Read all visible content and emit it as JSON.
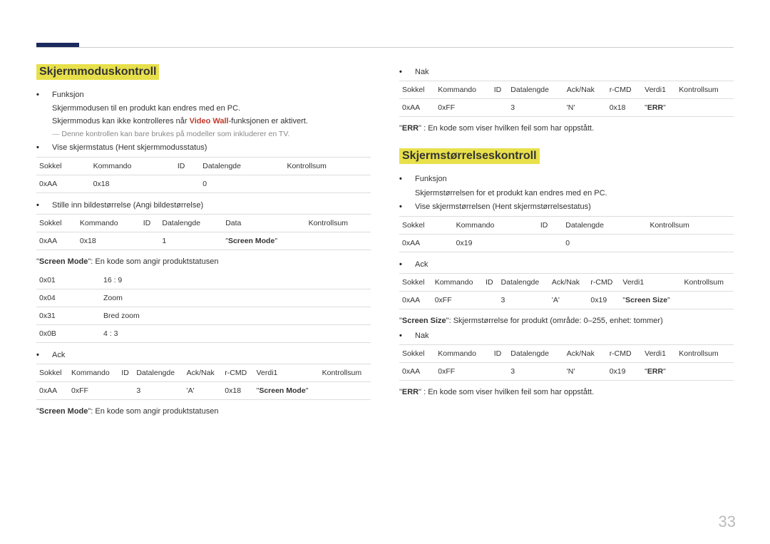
{
  "pageNumber": "33",
  "left": {
    "title": "Skjermmoduskontroll",
    "funksjonLabel": "Funksjon",
    "funksjonText1": "Skjermmodusen til en produkt kan endres med en PC.",
    "funksjonText2a": "Skjermmodus kan ikke kontrolleres når ",
    "funksjonText2Red": "Video Wall",
    "funksjonText2b": "-funksjonen er aktivert.",
    "note": "Denne kontrollen kan bare brukes på modeller som inkluderer en TV.",
    "vise": "Vise skjermstatus (Hent skjermmodusstatus)",
    "t1": {
      "h": [
        "Sokkel",
        "Kommando",
        "ID",
        "Datalengde",
        "Kontrollsum"
      ],
      "r": [
        "0xAA",
        "0x18",
        "",
        "0",
        ""
      ]
    },
    "stille": "Stille inn bildestørrelse (Angi bildestørrelse)",
    "t2": {
      "h": [
        "Sokkel",
        "Kommando",
        "ID",
        "Datalengde",
        "Data",
        "Kontrollsum"
      ],
      "r": [
        "0xAA",
        "0x18",
        "",
        "1",
        [
          "\"",
          "Screen Mode",
          "\""
        ],
        ""
      ]
    },
    "screenModeDesc": [
      "\"",
      "Screen Mode",
      "\": En kode som angir produktstatusen"
    ],
    "t3": {
      "rows": [
        [
          "0x01",
          "16 : 9"
        ],
        [
          "0x04",
          "Zoom"
        ],
        [
          "0x31",
          "Bred zoom"
        ],
        [
          "0x0B",
          "4 : 3"
        ]
      ]
    },
    "ackLabel": "Ack",
    "t4": {
      "h": [
        "Sokkel",
        "Kommando",
        "ID",
        "Datalengde",
        "Ack/Nak",
        "r-CMD",
        "Verdi1",
        "Kontrollsum"
      ],
      "r": [
        "0xAA",
        "0xFF",
        "",
        "3",
        "'A'",
        "0x18",
        [
          "\"",
          "Screen Mode",
          "\""
        ],
        ""
      ]
    },
    "screenModeDesc2": [
      "\"",
      "Screen Mode",
      "\": En kode som angir produktstatusen"
    ]
  },
  "right": {
    "nakLabel": "Nak",
    "t5": {
      "h": [
        "Sokkel",
        "Kommando",
        "ID",
        "Datalengde",
        "Ack/Nak",
        "r-CMD",
        "Verdi1",
        "Kontrollsum"
      ],
      "r": [
        "0xAA",
        "0xFF",
        "",
        "3",
        "'N'",
        "0x18",
        [
          "\"",
          "ERR",
          "\""
        ],
        ""
      ]
    },
    "errDesc": [
      "\"",
      "ERR",
      "\" : En kode som viser hvilken feil som har oppstått."
    ],
    "title": "Skjermstørrelseskontroll",
    "funksjonLabel": "Funksjon",
    "funksjonText": "Skjermstørrelsen for et produkt kan endres med en PC.",
    "vise": "Vise skjermstørrelsen (Hent skjermstørrelsestatus)",
    "t6": {
      "h": [
        "Sokkel",
        "Kommando",
        "ID",
        "Datalengde",
        "Kontrollsum"
      ],
      "r": [
        "0xAA",
        "0x19",
        "",
        "0",
        ""
      ]
    },
    "ackLabel": "Ack",
    "t7": {
      "h": [
        "Sokkel",
        "Kommando",
        "ID",
        "Datalengde",
        "Ack/Nak",
        "r-CMD",
        "Verdi1",
        "Kontrollsum"
      ],
      "r": [
        "0xAA",
        "0xFF",
        "",
        "3",
        "'A'",
        "0x19",
        [
          "\"",
          "Screen Size",
          "\""
        ],
        ""
      ]
    },
    "screenSizeDesc": [
      "\"",
      "Screen Size",
      "\": Skjermstørrelse for produkt (område: 0–255, enhet: tommer)"
    ],
    "nakLabel2": "Nak",
    "t8": {
      "h": [
        "Sokkel",
        "Kommando",
        "ID",
        "Datalengde",
        "Ack/Nak",
        "r-CMD",
        "Verdi1",
        "Kontrollsum"
      ],
      "r": [
        "0xAA",
        "0xFF",
        "",
        "3",
        "'N'",
        "0x19",
        [
          "\"",
          "ERR",
          "\""
        ],
        ""
      ]
    },
    "errDesc2": [
      "\"",
      "ERR",
      "\" : En kode som viser hvilken feil som har oppstått."
    ]
  }
}
